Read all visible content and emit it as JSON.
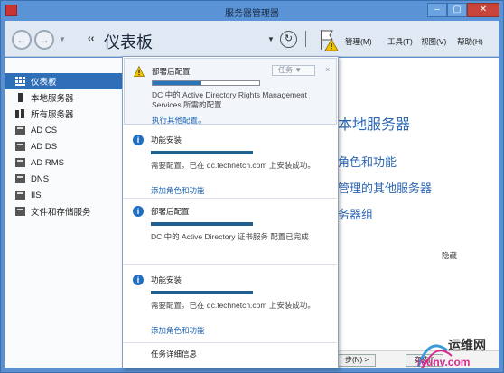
{
  "window": {
    "title": "服务器管理器",
    "controls": {
      "minimize": "–",
      "maximize": "▢",
      "close": "✕"
    }
  },
  "toolbar": {
    "breadcrumb_separator": "‹‹",
    "title": "仪表板",
    "menu": {
      "manage": "管理(M)",
      "tools": "工具(T)",
      "view": "视图(V)",
      "help": "帮助(H)"
    }
  },
  "sidebar": {
    "items": [
      {
        "label": "仪表板",
        "icon": "dashboard-icon",
        "active": true
      },
      {
        "label": "本地服务器",
        "icon": "server-icon",
        "active": false
      },
      {
        "label": "所有服务器",
        "icon": "servers-icon",
        "active": false
      },
      {
        "label": "AD CS",
        "icon": "adcs-icon",
        "active": false
      },
      {
        "label": "AD DS",
        "icon": "adds-icon",
        "active": false
      },
      {
        "label": "AD RMS",
        "icon": "adrms-icon",
        "active": false
      },
      {
        "label": "DNS",
        "icon": "dns-icon",
        "active": false
      },
      {
        "label": "IIS",
        "icon": "iis-icon",
        "active": false
      },
      {
        "label": "文件和存储服务",
        "icon": "storage-icon",
        "active": false
      }
    ]
  },
  "main": {
    "tile_title": "本地服务器",
    "tile_links": [
      "角色和功能",
      "管理的其他服务器",
      "务器组"
    ],
    "hide_label": "隐藏",
    "next_button": "步(N) >",
    "install_button": "安装(I)"
  },
  "notifications": {
    "task_dropdown": "任务",
    "close": "×",
    "items": [
      {
        "type": "warning",
        "title": "部署后配置",
        "progress": 0.45,
        "text": "DC 中的 Active Directory Rights Management Services 所需的配置",
        "link": "执行其他配置。"
      },
      {
        "type": "info",
        "title": "功能安装",
        "text": "需要配置。已在 dc.technetcn.com 上安装成功。",
        "link": "添加角色和功能"
      },
      {
        "type": "info",
        "title": "部署后配置",
        "text": "DC 中的 Active Directory 证书服务 配置已完成",
        "link": ""
      },
      {
        "type": "info",
        "title": "功能安装",
        "text": "需要配置。已在 dc.technetcn.com 上安装成功。",
        "link": "添加角色和功能"
      }
    ],
    "footer": "任务详细信息"
  },
  "watermark": {
    "site_name": "运维网",
    "url": "iyunv.com"
  },
  "colors": {
    "accent_blue": "#2f6fb8",
    "title_bar": "#5b94d6",
    "link_blue": "#1d62b0",
    "warning_yellow": "#f2c500",
    "progress_dark": "#205f8e"
  }
}
